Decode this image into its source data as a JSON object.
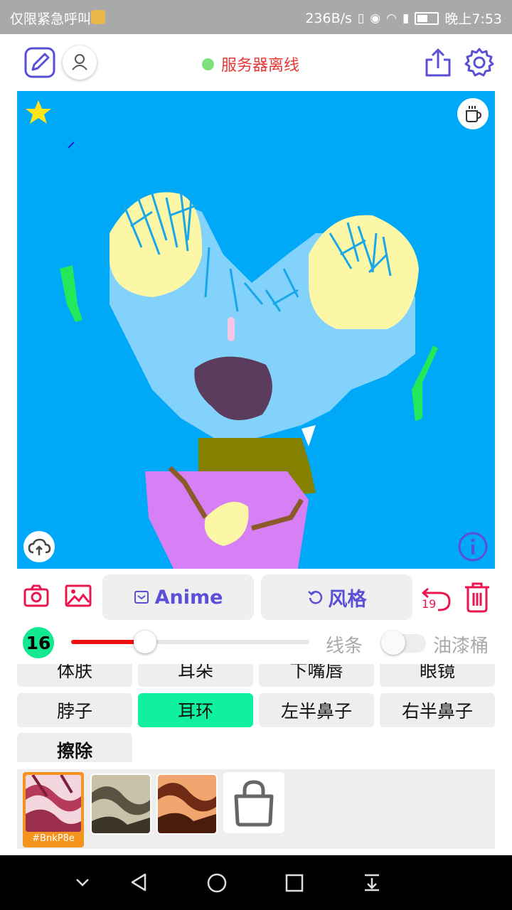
{
  "status_bar": {
    "left_text": "仅限紧急呼叫",
    "speed": "236B/s",
    "time": "晚上7:53"
  },
  "header": {
    "server_status": "服务器离线",
    "server_dot_color": "#7ee27a",
    "icons": [
      "edit-icon",
      "user-icon",
      "share-icon",
      "gear-icon"
    ]
  },
  "canvas": {
    "background": "#00a9f7",
    "icons": [
      "star-icon",
      "coffee-icon",
      "cloud-upload-icon",
      "info-icon"
    ]
  },
  "toolbar": {
    "anime_label": "Anime",
    "style_label": "风格",
    "undo_count": "19",
    "icons": [
      "camera-icon",
      "image-icon",
      "undo-icon",
      "trash-icon"
    ]
  },
  "brush": {
    "size": "16",
    "slider_fraction": 0.31,
    "lines_label": "线条",
    "bucket_label": "油漆桶",
    "bucket_enabled": false
  },
  "parts": [
    {
      "label": "体肤"
    },
    {
      "label": "耳朵"
    },
    {
      "label": "下嘴唇"
    },
    {
      "label": "眼镜"
    },
    {
      "label": "脖子"
    },
    {
      "label": "耳环",
      "selected": true
    },
    {
      "label": "左半鼻子"
    },
    {
      "label": "右半鼻子"
    },
    {
      "label": "擦除"
    }
  ],
  "textures": {
    "selected_tag": "#BnkP8e",
    "shop_icon": "shopping-bag-icon"
  },
  "colors": {
    "accent": "#5b4fd6",
    "danger": "#e8174f",
    "selected_part": "#0ff0a0"
  }
}
